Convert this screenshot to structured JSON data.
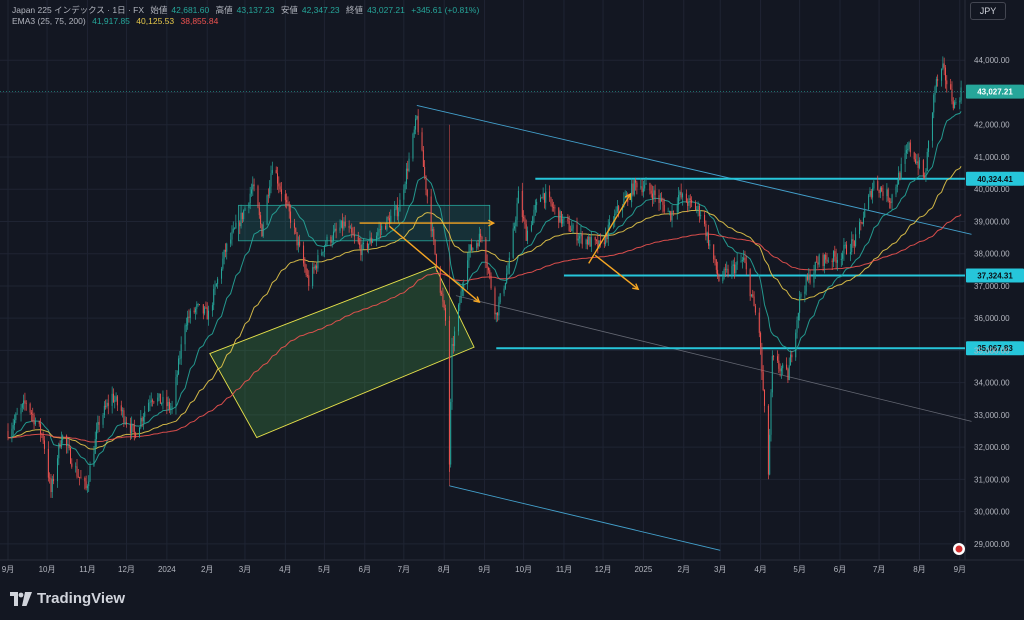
{
  "header": {
    "symbol": "Japan 225 インデックス · 1日 · FX",
    "open_label": "始値",
    "open": "42,681.60",
    "high_label": "高値",
    "high": "43,137.23",
    "low_label": "安値",
    "low": "42,347.23",
    "close_label": "終値",
    "close": "43,027.21",
    "change": "+345.61 (+0.81%)",
    "ema_label": "EMA3 (25, 75, 200)",
    "ema25": "41,917.85",
    "ema75": "40,125.53",
    "ema200": "38,855.84",
    "currency": "JPY"
  },
  "footer": {
    "brand": "TradingView"
  },
  "colors": {
    "background": "#131722",
    "up": "#26a69a",
    "down": "#ef5350",
    "ema25": "#26a69a",
    "ema75": "#e6c84a",
    "ema200": "#ef5350",
    "level": "#26c6da",
    "arrow": "#f5a623",
    "channel": "#4fc3f7"
  },
  "chart_data": {
    "type": "candlestick",
    "x_range": [
      "2023-09-01",
      "2025-09-05"
    ],
    "ylim": [
      28500,
      45000
    ],
    "y_ticks": [
      29000,
      30000,
      31000,
      32000,
      33000,
      34000,
      35000,
      36000,
      37000,
      38000,
      39000,
      40000,
      41000,
      42000,
      43000,
      44000
    ],
    "y_tick_labels": [
      "29,000.00",
      "30,000.00",
      "31,000.00",
      "32,000.00",
      "33,000.00",
      "34,000.00",
      "35,000.00",
      "36,000.00",
      "37,000.00",
      "38,000.00",
      "39,000.00",
      "40,000.00",
      "41,000.00",
      "42,000.00",
      "43,000.00",
      "44,000.00"
    ],
    "x_ticks": [
      {
        "date": "2023-09-01",
        "label": "9月"
      },
      {
        "date": "2023-10-01",
        "label": "10月"
      },
      {
        "date": "2023-11-01",
        "label": "11月"
      },
      {
        "date": "2023-12-01",
        "label": "12月"
      },
      {
        "date": "2024-01-01",
        "label": "2024"
      },
      {
        "date": "2024-02-01",
        "label": "2月"
      },
      {
        "date": "2024-03-01",
        "label": "3月"
      },
      {
        "date": "2024-04-01",
        "label": "4月"
      },
      {
        "date": "2024-05-01",
        "label": "5月"
      },
      {
        "date": "2024-06-01",
        "label": "6月"
      },
      {
        "date": "2024-07-01",
        "label": "7月"
      },
      {
        "date": "2024-08-01",
        "label": "8月"
      },
      {
        "date": "2024-09-01",
        "label": "9月"
      },
      {
        "date": "2024-10-01",
        "label": "10月"
      },
      {
        "date": "2024-11-01",
        "label": "11月"
      },
      {
        "date": "2024-12-01",
        "label": "12月"
      },
      {
        "date": "2025-01-01",
        "label": "2025"
      },
      {
        "date": "2025-02-01",
        "label": "2月"
      },
      {
        "date": "2025-03-01",
        "label": "3月"
      },
      {
        "date": "2025-04-01",
        "label": "4月"
      },
      {
        "date": "2025-05-01",
        "label": "5月"
      },
      {
        "date": "2025-06-01",
        "label": "6月"
      },
      {
        "date": "2025-07-01",
        "label": "7月"
      },
      {
        "date": "2025-08-01",
        "label": "8月"
      },
      {
        "date": "2025-09-01",
        "label": "9月"
      }
    ],
    "price_path": [
      [
        "2023-09-01",
        32500
      ],
      [
        "2023-09-15",
        33400
      ],
      [
        "2023-09-28",
        32300
      ],
      [
        "2023-10-04",
        30600
      ],
      [
        "2023-10-12",
        32400
      ],
      [
        "2023-10-24",
        31200
      ],
      [
        "2023-10-31",
        30700
      ],
      [
        "2023-11-10",
        32800
      ],
      [
        "2023-11-20",
        33600
      ],
      [
        "2023-12-07",
        32400
      ],
      [
        "2023-12-20",
        33600
      ],
      [
        "2024-01-05",
        33200
      ],
      [
        "2024-01-15",
        35900
      ],
      [
        "2024-01-24",
        36300
      ],
      [
        "2024-02-02",
        36100
      ],
      [
        "2024-02-15",
        38100
      ],
      [
        "2024-02-28",
        39200
      ],
      [
        "2024-03-07",
        40100
      ],
      [
        "2024-03-14",
        38700
      ],
      [
        "2024-03-22",
        40800
      ],
      [
        "2024-04-05",
        39100
      ],
      [
        "2024-04-19",
        37100
      ],
      [
        "2024-05-01",
        38300
      ],
      [
        "2024-05-16",
        38900
      ],
      [
        "2024-05-30",
        38100
      ],
      [
        "2024-06-14",
        38800
      ],
      [
        "2024-06-27",
        39400
      ],
      [
        "2024-07-05",
        40900
      ],
      [
        "2024-07-11",
        42200
      ],
      [
        "2024-07-25",
        38000
      ],
      [
        "2024-08-02",
        35900
      ],
      [
        "2024-08-05",
        31500
      ],
      [
        "2024-08-07",
        35000
      ],
      [
        "2024-08-19",
        38000
      ],
      [
        "2024-08-30",
        38600
      ],
      [
        "2024-09-10",
        36100
      ],
      [
        "2024-09-20",
        37700
      ],
      [
        "2024-09-27",
        39800
      ],
      [
        "2024-10-03",
        38600
      ],
      [
        "2024-10-15",
        39900
      ],
      [
        "2024-10-31",
        39000
      ],
      [
        "2024-11-14",
        38500
      ],
      [
        "2024-11-29",
        38200
      ],
      [
        "2024-12-13",
        39400
      ],
      [
        "2024-12-27",
        40200
      ],
      [
        "2025-01-08",
        39900
      ],
      [
        "2025-01-22",
        39200
      ],
      [
        "2025-01-28",
        39800
      ],
      [
        "2025-02-14",
        39300
      ],
      [
        "2025-02-28",
        37200
      ],
      [
        "2025-03-19",
        37800
      ],
      [
        "2025-03-31",
        35600
      ],
      [
        "2025-04-07",
        31200
      ],
      [
        "2025-04-10",
        34700
      ],
      [
        "2025-04-22",
        34200
      ],
      [
        "2025-05-02",
        36800
      ],
      [
        "2025-05-16",
        37800
      ],
      [
        "2025-05-30",
        37900
      ],
      [
        "2025-06-13",
        38400
      ],
      [
        "2025-06-27",
        40200
      ],
      [
        "2025-07-10",
        39700
      ],
      [
        "2025-07-24",
        41300
      ],
      [
        "2025-07-31",
        40800
      ],
      [
        "2025-08-05",
        40300
      ],
      [
        "2025-08-13",
        43200
      ],
      [
        "2025-08-19",
        43700
      ],
      [
        "2025-08-28",
        42600
      ],
      [
        "2025-09-02",
        43027
      ]
    ],
    "levels": [
      {
        "price": 40324.41,
        "label": "40,324.41",
        "from": "2024-10-10"
      },
      {
        "price": 37324.31,
        "label": "37,324.31",
        "from": "2024-11-01"
      },
      {
        "price": 35067.83,
        "label": "35,067.83",
        "from": "2024-09-10"
      }
    ],
    "last_price": {
      "price": 43027.21,
      "label": "43,027.21"
    }
  }
}
